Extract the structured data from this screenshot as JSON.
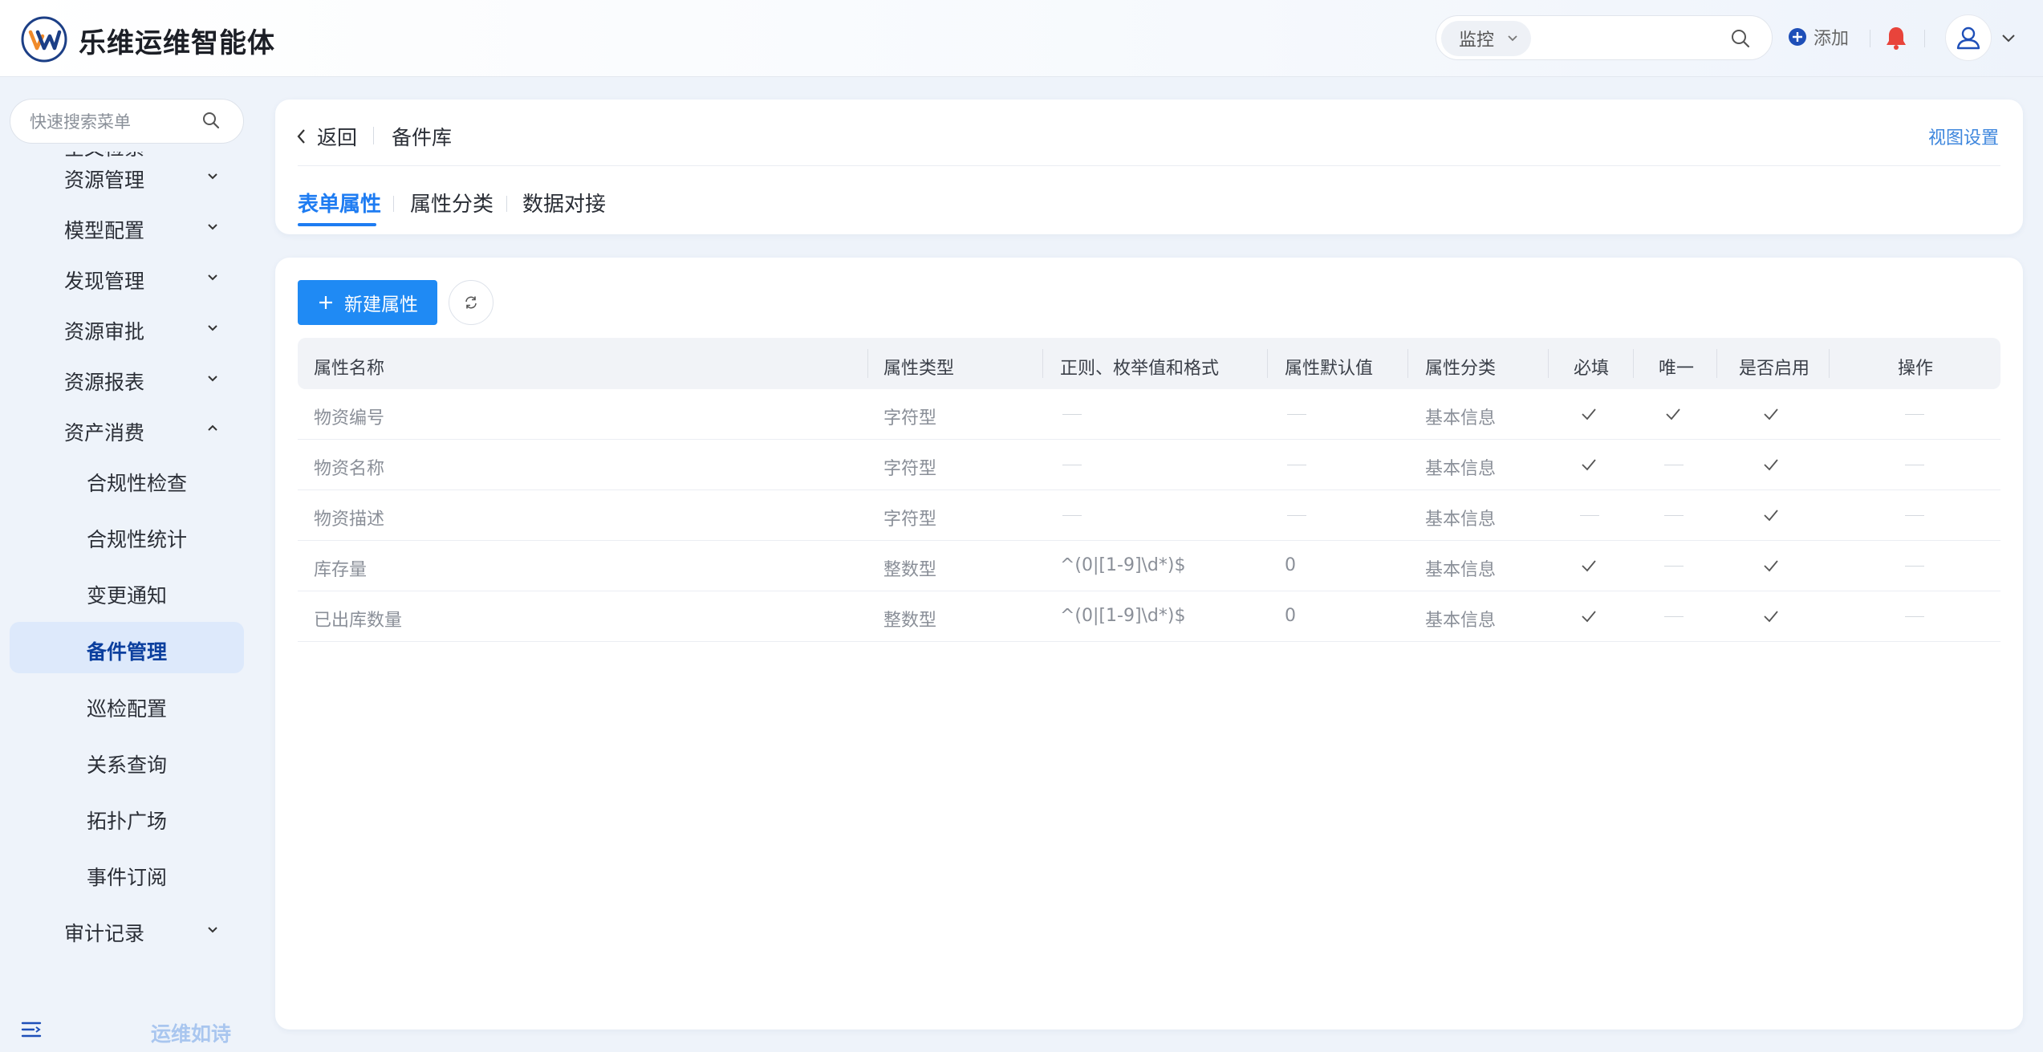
{
  "app": {
    "title": "乐维运维智能体"
  },
  "header": {
    "search_scope": "监控",
    "add_label": "添加"
  },
  "sidebar": {
    "search_placeholder": "快速搜索菜单",
    "partial_item": "全文检索",
    "items": [
      {
        "label": "资源管理",
        "expanded": false
      },
      {
        "label": "模型配置",
        "expanded": false
      },
      {
        "label": "发现管理",
        "expanded": false
      },
      {
        "label": "资源审批",
        "expanded": false
      },
      {
        "label": "资源报表",
        "expanded": false
      },
      {
        "label": "资产消费",
        "expanded": true
      }
    ],
    "sub_items": [
      "合规性检查",
      "合规性统计",
      "变更通知",
      "备件管理",
      "巡检配置",
      "关系查询",
      "拓扑广场",
      "事件订阅"
    ],
    "active_sub": "备件管理",
    "after_item": {
      "label": "审计记录",
      "expanded": false
    },
    "footer_slogan": "运维如诗"
  },
  "page": {
    "back_label": "返回",
    "breadcrumb_current": "备件库",
    "view_settings": "视图设置",
    "tabs": [
      {
        "label": "表单属性",
        "active": true
      },
      {
        "label": "属性分类",
        "active": false
      },
      {
        "label": "数据对接",
        "active": false
      }
    ]
  },
  "toolbar": {
    "new_label": "新建属性"
  },
  "table": {
    "columns": [
      "属性名称",
      "属性类型",
      "正则、枚举值和格式",
      "属性默认值",
      "属性分类",
      "必填",
      "唯一",
      "是否启用",
      "操作"
    ],
    "rows": [
      {
        "name": "物资编号",
        "type": "字符型",
        "regex": "",
        "default": "",
        "category": "基本信息",
        "required": true,
        "unique": true,
        "enabled": true
      },
      {
        "name": "物资名称",
        "type": "字符型",
        "regex": "",
        "default": "",
        "category": "基本信息",
        "required": true,
        "unique": false,
        "enabled": true
      },
      {
        "name": "物资描述",
        "type": "字符型",
        "regex": "",
        "default": "",
        "category": "基本信息",
        "required": false,
        "unique": false,
        "enabled": true
      },
      {
        "name": "库存量",
        "type": "整数型",
        "regex": "^(0|[1-9]\\d*)$",
        "default": "0",
        "category": "基本信息",
        "required": true,
        "unique": false,
        "enabled": true
      },
      {
        "name": "已出库数量",
        "type": "整数型",
        "regex": "^(0|[1-9]\\d*)$",
        "default": "0",
        "category": "基本信息",
        "required": true,
        "unique": false,
        "enabled": true
      }
    ]
  },
  "colors": {
    "accent": "#1f8af4",
    "active_bg": "#dde9fb",
    "active_text": "#0b3f9e",
    "bell": "#e8443b"
  }
}
